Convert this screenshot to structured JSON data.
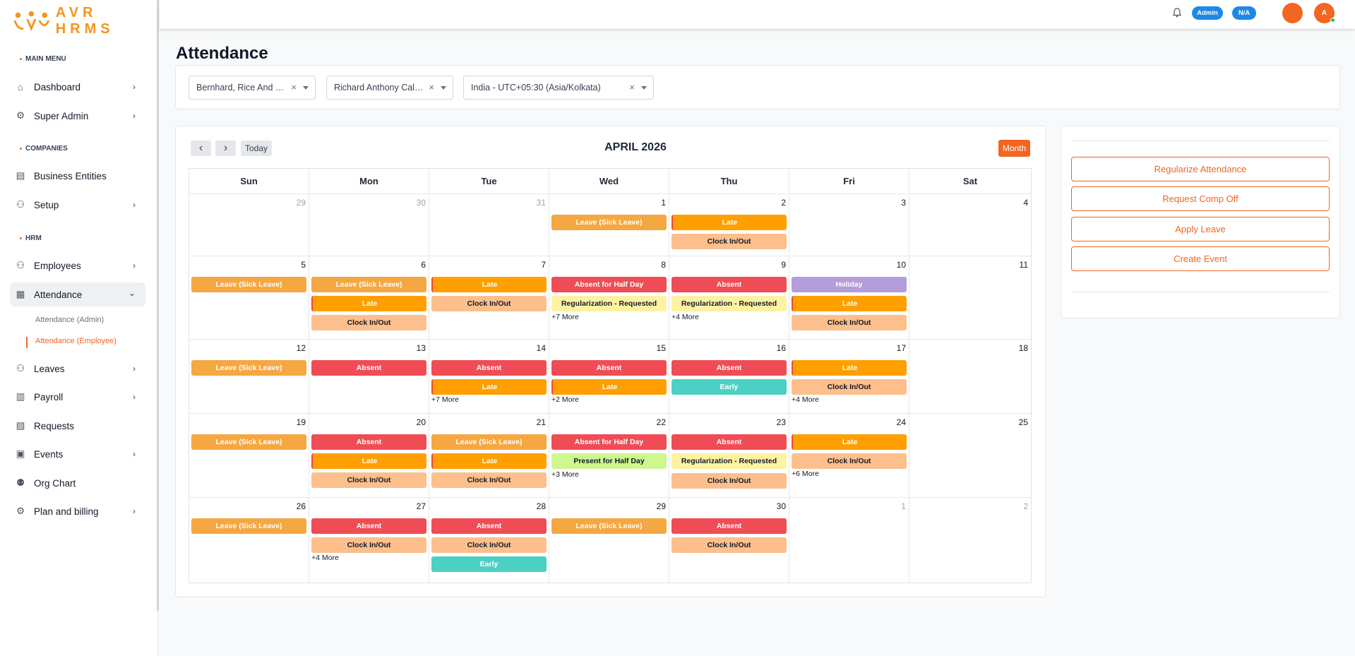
{
  "app": {
    "name": "AVR HRMS"
  },
  "sidebar": {
    "sections": {
      "main": "MAIN MENU",
      "companies": "COMPANIES",
      "hrm": "HRM"
    },
    "items": {
      "dashboard": "Dashboard",
      "super_admin": "Super Admin",
      "business_entities": "Business Entities",
      "setup": "Setup",
      "employees": "Employees",
      "attendance": "Attendance",
      "attendance_admin": "Attendance (Admin)",
      "attendance_employee": "Attendance (Employee)",
      "leaves": "Leaves",
      "payroll": "Payroll",
      "requests": "Requests",
      "events": "Events",
      "org_chart": "Org Chart",
      "plan_billing": "Plan and billing"
    }
  },
  "topbar": {
    "role_badge": "Admin",
    "na_badge": "N/A",
    "avatar_letter": "A",
    "colors": {
      "badge": "#1e88e5",
      "avatar": "#f26522"
    }
  },
  "page": {
    "title": "Attendance"
  },
  "filters": {
    "company": "Bernhard, Rice And Runolfsdottir",
    "employee": "Richard Anthony Caldwell",
    "timezone": "India - UTC+05:30 (Asia/Kolkata)"
  },
  "calendar": {
    "title": "APRIL 2026",
    "today_label": "Today",
    "view_label": "Month",
    "weekdays": [
      "Sun",
      "Mon",
      "Tue",
      "Wed",
      "Thu",
      "Fri",
      "Sat"
    ],
    "weeks": [
      [
        {
          "day": "29",
          "other": true,
          "events": []
        },
        {
          "day": "30",
          "other": true,
          "events": []
        },
        {
          "day": "31",
          "other": true,
          "events": []
        },
        {
          "day": "1",
          "events": [
            {
              "label": "Leave (Sick Leave)",
              "type": "leave"
            }
          ]
        },
        {
          "day": "2",
          "events": [
            {
              "label": "Late",
              "type": "late",
              "bar": true
            },
            {
              "label": "Clock In/Out",
              "type": "clock"
            }
          ]
        },
        {
          "day": "3",
          "events": []
        },
        {
          "day": "4",
          "events": []
        }
      ],
      [
        {
          "day": "5",
          "events": [
            {
              "label": "Leave (Sick Leave)",
              "type": "leave"
            }
          ]
        },
        {
          "day": "6",
          "events": [
            {
              "label": "Leave (Sick Leave)",
              "type": "leave"
            },
            {
              "label": "Late",
              "type": "late",
              "bar": true
            },
            {
              "label": "Clock In/Out",
              "type": "clock"
            }
          ]
        },
        {
          "day": "7",
          "events": [
            {
              "label": "Late",
              "type": "late",
              "bar": true
            },
            {
              "label": "Clock In/Out",
              "type": "clock"
            }
          ]
        },
        {
          "day": "8",
          "events": [
            {
              "label": "Absent for Half Day",
              "type": "absent"
            },
            {
              "label": "Regularization - Requested",
              "type": "reg"
            }
          ],
          "more": "+7 More"
        },
        {
          "day": "9",
          "events": [
            {
              "label": "Absent",
              "type": "absent"
            },
            {
              "label": "Regularization - Requested",
              "type": "reg"
            }
          ],
          "more": "+4 More"
        },
        {
          "day": "10",
          "events": [
            {
              "label": "Holiday",
              "type": "holiday"
            },
            {
              "label": "Late",
              "type": "late",
              "bar": true
            },
            {
              "label": "Clock In/Out",
              "type": "clock"
            }
          ]
        },
        {
          "day": "11",
          "events": []
        }
      ],
      [
        {
          "day": "12",
          "events": [
            {
              "label": "Leave (Sick Leave)",
              "type": "leave"
            }
          ]
        },
        {
          "day": "13",
          "events": [
            {
              "label": "Absent",
              "type": "absent"
            }
          ]
        },
        {
          "day": "14",
          "events": [
            {
              "label": "Absent",
              "type": "absent"
            },
            {
              "label": "Late",
              "type": "late",
              "bar": true
            }
          ],
          "more": "+7 More"
        },
        {
          "day": "15",
          "events": [
            {
              "label": "Absent",
              "type": "absent"
            },
            {
              "label": "Late",
              "type": "late",
              "bar": true
            }
          ],
          "more": "+2 More"
        },
        {
          "day": "16",
          "events": [
            {
              "label": "Absent",
              "type": "absent"
            },
            {
              "label": "Early",
              "type": "early"
            }
          ]
        },
        {
          "day": "17",
          "events": [
            {
              "label": "Late",
              "type": "late",
              "bar": true
            },
            {
              "label": "Clock In/Out",
              "type": "clock"
            }
          ],
          "more": "+4 More"
        },
        {
          "day": "18",
          "events": []
        }
      ],
      [
        {
          "day": "19",
          "events": [
            {
              "label": "Leave (Sick Leave)",
              "type": "leave"
            }
          ]
        },
        {
          "day": "20",
          "events": [
            {
              "label": "Absent",
              "type": "absent"
            },
            {
              "label": "Late",
              "type": "late",
              "bar": true
            },
            {
              "label": "Clock In/Out",
              "type": "clock"
            }
          ]
        },
        {
          "day": "21",
          "events": [
            {
              "label": "Leave (Sick Leave)",
              "type": "leave"
            },
            {
              "label": "Late",
              "type": "late",
              "bar": true
            },
            {
              "label": "Clock In/Out",
              "type": "clock"
            }
          ]
        },
        {
          "day": "22",
          "events": [
            {
              "label": "Absent for Half Day",
              "type": "absent"
            },
            {
              "label": "Present for Half Day",
              "type": "present"
            }
          ],
          "more": "+3 More"
        },
        {
          "day": "23",
          "events": [
            {
              "label": "Absent",
              "type": "absent"
            },
            {
              "label": "Regularization - Requested",
              "type": "reg"
            },
            {
              "label": "Clock In/Out",
              "type": "clock"
            }
          ]
        },
        {
          "day": "24",
          "events": [
            {
              "label": "Late",
              "type": "late",
              "bar": true
            },
            {
              "label": "Clock In/Out",
              "type": "clock"
            }
          ],
          "more": "+6 More"
        },
        {
          "day": "25",
          "events": []
        }
      ],
      [
        {
          "day": "26",
          "events": [
            {
              "label": "Leave (Sick Leave)",
              "type": "leave"
            }
          ]
        },
        {
          "day": "27",
          "events": [
            {
              "label": "Absent",
              "type": "absent"
            },
            {
              "label": "Clock In/Out",
              "type": "clock"
            }
          ],
          "more": "+4 More"
        },
        {
          "day": "28",
          "events": [
            {
              "label": "Absent",
              "type": "absent"
            },
            {
              "label": "Clock In/Out",
              "type": "clock"
            },
            {
              "label": "Early",
              "type": "early"
            }
          ]
        },
        {
          "day": "29",
          "events": [
            {
              "label": "Leave (Sick Leave)",
              "type": "leave"
            }
          ]
        },
        {
          "day": "30",
          "events": [
            {
              "label": "Absent",
              "type": "absent"
            },
            {
              "label": "Clock In/Out",
              "type": "clock"
            }
          ]
        },
        {
          "day": "1",
          "other": true,
          "events": []
        },
        {
          "day": "2",
          "other": true,
          "events": []
        }
      ]
    ]
  },
  "event_colors": {
    "leave": {
      "bg": "#f5a742",
      "fg": "#ffffff"
    },
    "late": {
      "bg": "#ff9f00",
      "fg": "#ffffff"
    },
    "clock": {
      "bg": "#fdbf8c",
      "fg": "#111827"
    },
    "absent": {
      "bg": "#f04c55",
      "fg": "#ffffff"
    },
    "reg": {
      "bg": "#fff3a3",
      "fg": "#111827"
    },
    "holiday": {
      "bg": "#b39ddb",
      "fg": "#ffffff"
    },
    "early": {
      "bg": "#4dd0c4",
      "fg": "#ffffff"
    },
    "present": {
      "bg": "#cdf78f",
      "fg": "#111827"
    }
  },
  "actions": {
    "regularize": "Regularize Attendance",
    "comp_off": "Request Comp Off",
    "apply_leave": "Apply Leave",
    "create_event": "Create Event"
  }
}
